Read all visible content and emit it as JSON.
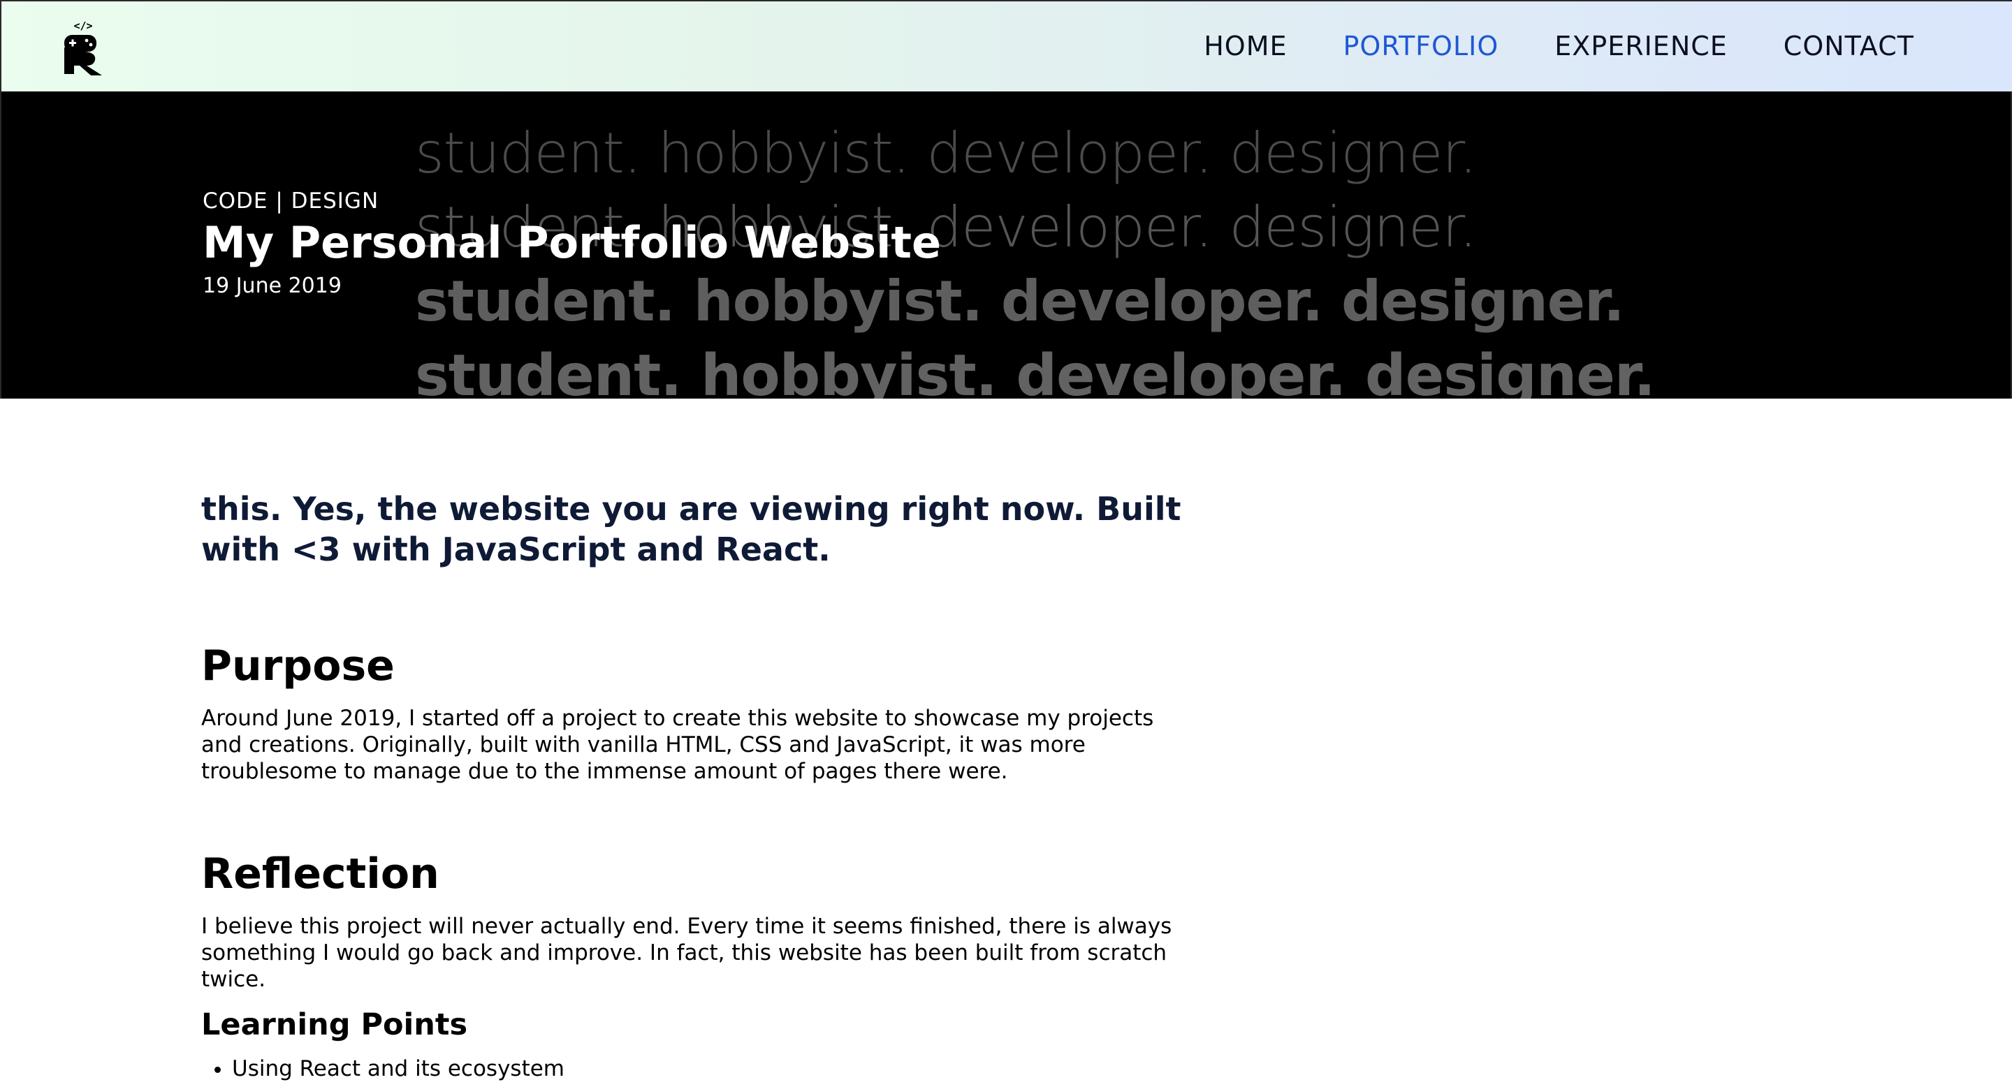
{
  "header": {
    "logo_icon": "R-gamepad-code-logo",
    "nav": [
      {
        "label": "HOME",
        "active": false
      },
      {
        "label": "PORTFOLIO",
        "active": true
      },
      {
        "label": "EXPERIENCE",
        "active": false
      },
      {
        "label": "CONTACT",
        "active": false
      }
    ],
    "active_color": "#1f57d6"
  },
  "hero": {
    "category": "CODE | DESIGN",
    "title": "My Personal Portfolio Website",
    "date": "19 June 2019",
    "tagline_rows": [
      "student. hobbyist. developer. designer.",
      "student. hobbyist. developer. designer.",
      "student. hobbyist. developer. designer.",
      "student. hobbyist. developer. designer."
    ]
  },
  "content": {
    "lead": "this. Yes, the website you are viewing right now. Built with <3 with JavaScript and React.",
    "purpose": {
      "heading": "Purpose",
      "text": "Around June 2019, I started off a project to create this website to showcase my projects and creations. Originally, built with vanilla HTML, CSS and JavaScript, it was more troublesome to manage due to the immense amount of pages there were."
    },
    "reflection": {
      "heading": "Reflection",
      "text": "I believe this project will never actually end. Every time it seems finished, there is always something I would go back and improve. In fact, this website has been built from scratch twice."
    },
    "learning": {
      "heading": "Learning Points",
      "items": [
        "Using React and its ecosystem"
      ]
    }
  }
}
